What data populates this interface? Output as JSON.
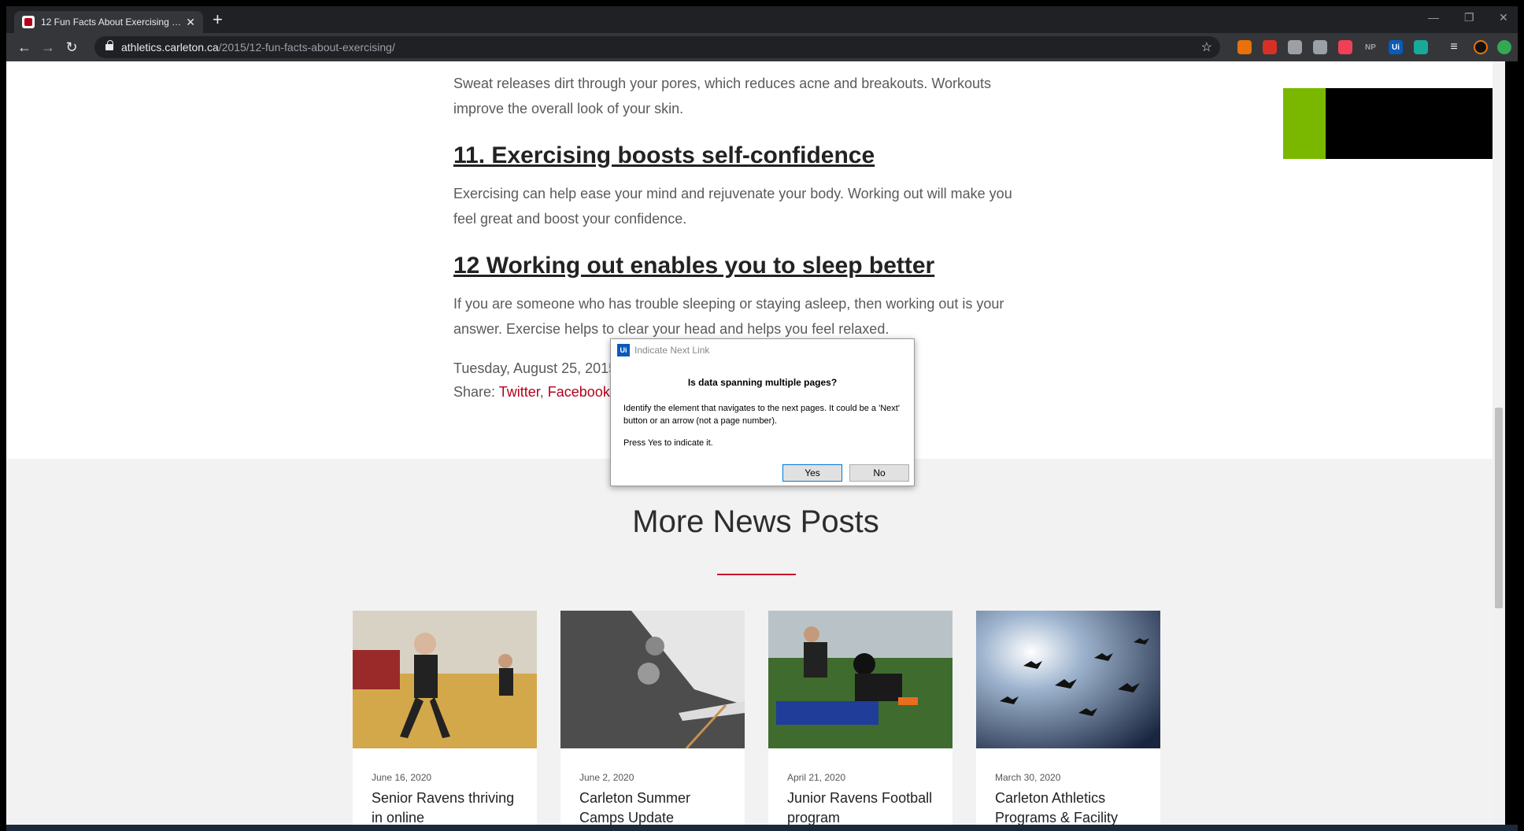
{
  "browser": {
    "tab_title": "12 Fun Facts About Exercising | C",
    "tab_close": "✕",
    "new_tab": "+",
    "url_host": "athletics.carleton.ca",
    "url_path": "/2015/12-fun-facts-about-exercising/",
    "extensions": [
      {
        "name": "ext-orange",
        "label": "",
        "color": "#e8710a"
      },
      {
        "name": "ext-red",
        "label": "",
        "color": "#d93025"
      },
      {
        "name": "ext-grey",
        "label": "",
        "color": "#9aa0a6"
      },
      {
        "name": "ext-print",
        "label": "",
        "color": "#9aa0a6"
      },
      {
        "name": "ext-pocket",
        "label": "",
        "color": "#ef4056"
      },
      {
        "name": "ext-np",
        "label": "NP",
        "color": "#35363a"
      },
      {
        "name": "ext-ui",
        "label": "Ui",
        "color": "#0a5aba"
      },
      {
        "name": "ext-teal",
        "label": "",
        "color": "#18a999"
      }
    ]
  },
  "article": {
    "p_skin": "Sweat releases dirt through your pores, which reduces acne and breakouts. Workouts improve the overall look of your skin.",
    "h_11": "11. Exercising boosts self-confidence",
    "p_11": "Exercising can help ease your mind and rejuvenate your body. Working out will make you feel great and boost your confidence.",
    "h_12": "12 Working out enables you to sleep better",
    "p_12": "If you are someone who has trouble sleeping or staying asleep, then working out is your answer. Exercise helps to clear your head and helps you feel relaxed.",
    "date": "Tuesday, August 25, 2015",
    "share_label": "Share:",
    "share_twitter": "Twitter",
    "share_sep": ",",
    "share_facebook": "Facebook"
  },
  "more_news": {
    "title": "More News Posts",
    "cards": [
      {
        "date": "June 16, 2020",
        "title": "Senior Ravens thriving in online"
      },
      {
        "date": "June 2, 2020",
        "title": "Carleton Summer Camps Update"
      },
      {
        "date": "April 21, 2020",
        "title": "Junior Ravens Football program"
      },
      {
        "date": "March 30, 2020",
        "title": "Carleton Athletics Programs & Facility"
      }
    ]
  },
  "dialog": {
    "window_title": "Indicate Next Link",
    "logo": "Ui",
    "question": "Is data spanning multiple pages?",
    "message": "Identify the element that navigates to the next pages. It could be a 'Next' button or an arrow (not a page number).",
    "instruction": "Press Yes to indicate it.",
    "yes_label": "Yes",
    "no_label": "No"
  },
  "colors": {
    "accent_red": "#b3001b",
    "ad_green": "#7ab800",
    "dialog_logo": "#0a5aba"
  }
}
